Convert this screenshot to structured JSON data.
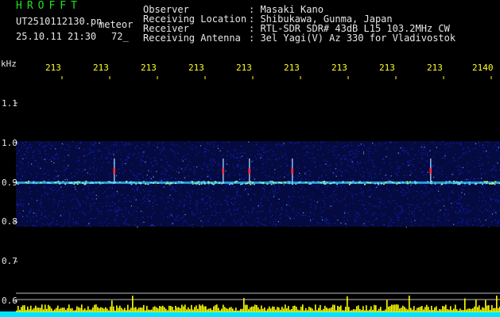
{
  "brand": "HROFFT",
  "file": {
    "name": "UT2510112130.pn",
    "type": "meteor",
    "datetime": "25.10.11 21:30",
    "count": "72_"
  },
  "info": {
    "labels": [
      "Observer",
      "Receiving Location",
      "Receiver",
      "Receiving Antenna"
    ],
    "values": [
      ": Masaki Kano",
      ": Shibukawa, Gunma, Japan",
      ": RTL-SDR SDR# 43dB L15 103.2MHz CW",
      ": 3el Yagi(V) Az 330 for Vladivostok"
    ]
  },
  "axis": {
    "unit": "kHz",
    "y_ticks": [
      "1.1",
      "1.0",
      "0.9",
      "0.8",
      "0.7",
      "0.6"
    ],
    "x_ticks": [
      "213",
      "213",
      "213",
      "213",
      "213",
      "213",
      "213",
      "213",
      "213",
      "2140"
    ]
  },
  "colors": {
    "noise": "#1a2aff",
    "line": "#33ccff",
    "echo": "#ff3344",
    "bars": "#ffff00",
    "base": "#00e5ff"
  }
}
